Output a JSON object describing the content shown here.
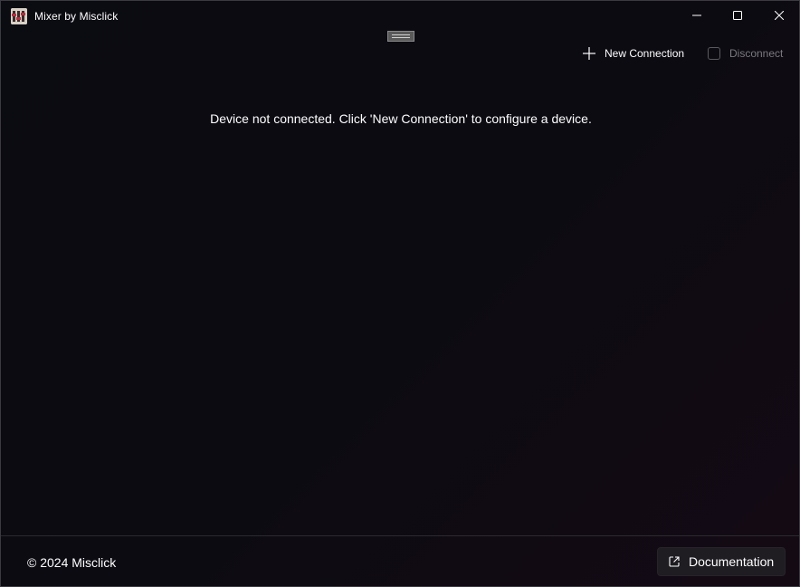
{
  "window": {
    "title": "Mixer by Misclick",
    "app_icon": "mixer-app-icon"
  },
  "caption_buttons": {
    "minimize_icon": "minimize-icon",
    "maximize_icon": "maximize-icon",
    "close_icon": "close-icon"
  },
  "toolbar": {
    "new_connection_label": "New Connection",
    "new_connection_icon": "plus-icon",
    "disconnect_label": "Disconnect",
    "disconnect_icon": "checkbox-icon"
  },
  "main": {
    "status_message": "Device not connected. Click 'New Connection' to configure a device."
  },
  "footer": {
    "copyright": "© 2024 Misclick",
    "documentation_label": "Documentation",
    "documentation_icon": "external-link-icon"
  },
  "colors": {
    "background": "#0c0a10",
    "text": "#ffffff",
    "disabled_text": "#7a7a7e",
    "button_bg": "#1f1c22"
  }
}
